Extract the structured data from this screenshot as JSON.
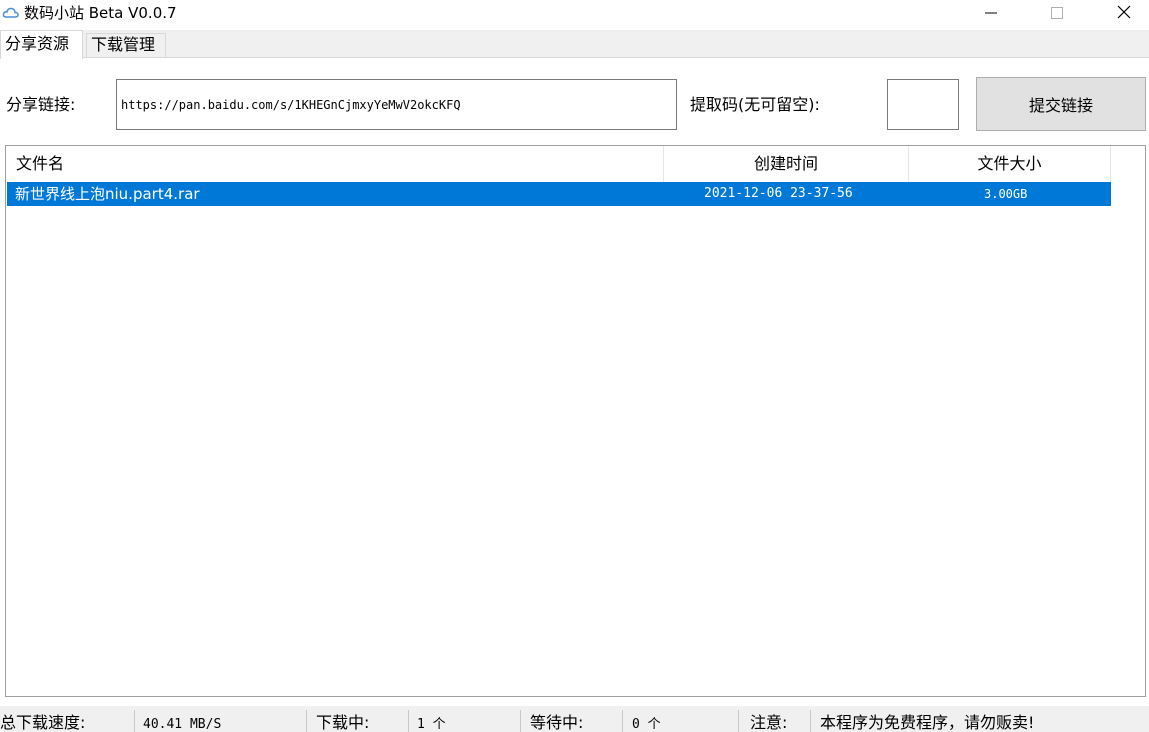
{
  "window": {
    "title": "数码小站 Beta V0.0.7",
    "icon": "cloud-icon",
    "accent_color": "#0078d7"
  },
  "tabs": [
    {
      "label": "分享资源",
      "active": true
    },
    {
      "label": "下载管理",
      "active": false
    }
  ],
  "share_form": {
    "link_label": "分享链接:",
    "link_value": "https://pan.baidu.com/s/1KHEGnCjmxyYeMwV2okcKFQ",
    "code_label": "提取码(无可留空):",
    "code_value": "",
    "submit_label": "提交链接"
  },
  "file_list": {
    "columns": [
      "文件名",
      "创建时间",
      "文件大小"
    ],
    "rows": [
      {
        "name": "新世界线上泡niu.part4.rar",
        "created": "2021-12-06 23-37-56",
        "size": "3.00GB",
        "selected": true
      }
    ]
  },
  "status": {
    "speed_label": "总下载速度:",
    "speed_value": "40.41 MB/S",
    "downloading_label": "下载中:",
    "downloading_value": "1 个",
    "waiting_label": "等待中:",
    "waiting_value": "0 个",
    "notice_label": "注意:",
    "notice_value": "本程序为免费程序，请勿贩卖!"
  }
}
